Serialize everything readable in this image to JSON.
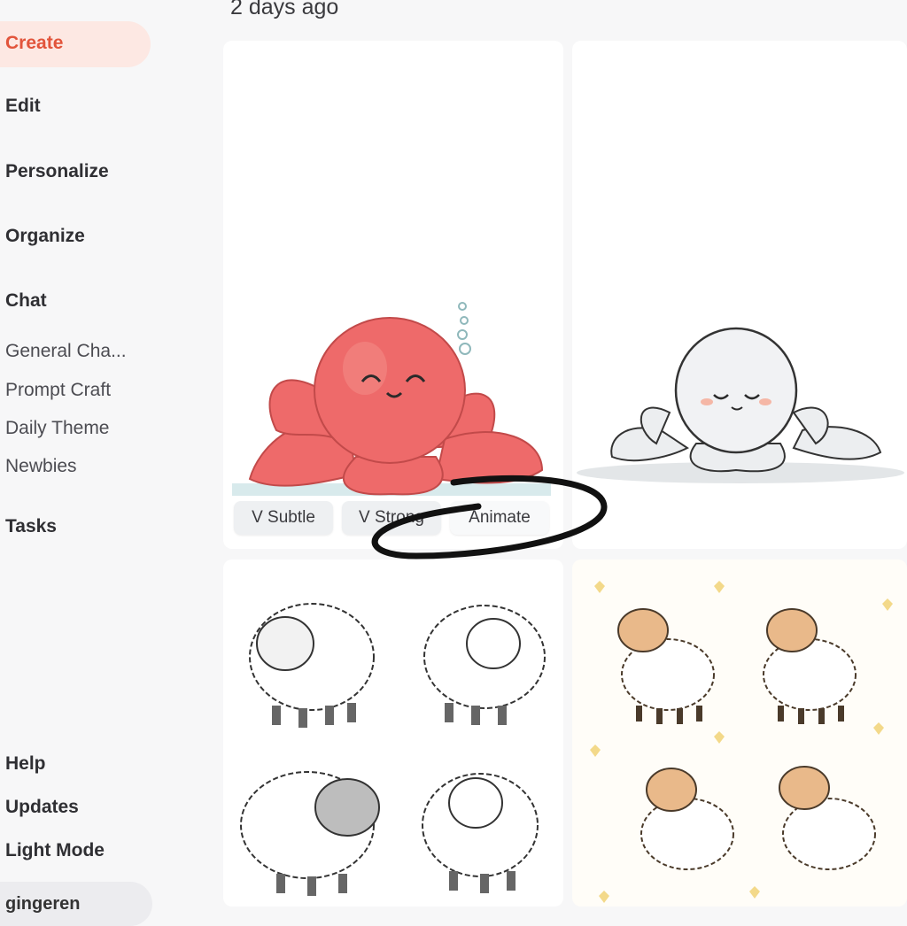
{
  "sidebar": {
    "nav": {
      "create": "Create",
      "edit": "Edit",
      "personalize": "Personalize",
      "organize": "Organize",
      "chat": "Chat",
      "tasks": "Tasks"
    },
    "chat_rooms": [
      "General Cha...",
      "Prompt Craft",
      "Daily Theme",
      "Newbies"
    ],
    "bottom": {
      "help": "Help",
      "updates": "Updates",
      "light_mode": "Light Mode",
      "username": "gingeren"
    }
  },
  "main": {
    "section_date": "2 days ago",
    "image_actions": {
      "vary_subtle": "V Subtle",
      "vary_strong": "V Strong",
      "animate": "Animate"
    },
    "images": [
      {
        "icon": "pink-octopus-image"
      },
      {
        "icon": "gray-octopus-image"
      },
      {
        "icon": "white-sheep-sketch-image"
      },
      {
        "icon": "tan-sheep-hearts-image"
      }
    ]
  },
  "colors": {
    "accent": "#e2543b",
    "active_bg": "#fde8e3",
    "octopus_pink": "#ee6a6a",
    "sheep_face": "#e9b98a"
  }
}
